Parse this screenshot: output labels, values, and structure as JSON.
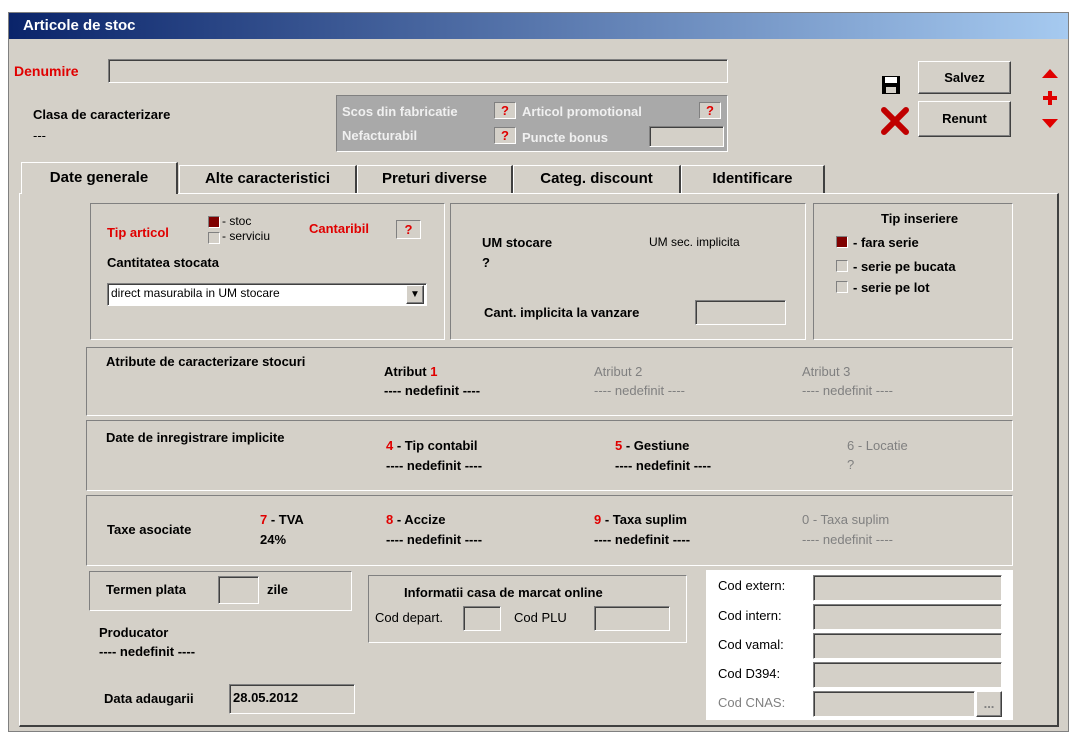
{
  "window": {
    "title": "Articole de stoc"
  },
  "header": {
    "denumire_label": "Denumire",
    "denumire_value": "",
    "clasa_label": "Clasa de caracterizare",
    "clasa_value": "---",
    "flags": {
      "scos_label": "Scos din fabricatie",
      "promo_label": "Articol promotional",
      "nefact_label": "Nefacturabil",
      "bonus_label": "Puncte bonus",
      "q": "?"
    },
    "save_label": "Salvez",
    "cancel_label": "Renunt"
  },
  "tabs": [
    "Date generale",
    "Alte caracteristici",
    "Preturi diverse",
    "Categ. discount",
    "Identificare"
  ],
  "tip_articol": {
    "label": "Tip articol",
    "opt_stoc": "- stoc",
    "opt_serviciu": "- serviciu",
    "cantaribil_label": "Cantaribil",
    "cantaribil_value": "?",
    "cantitate_label": "Cantitatea stocata",
    "cantitate_value": "direct masurabila in UM stocare"
  },
  "um": {
    "stocare_label": "UM stocare",
    "stocare_value": "?",
    "sec_label": "UM sec. implicita",
    "cant_vanzare_label": "Cant. implicita la vanzare"
  },
  "inseriere": {
    "title": "Tip inseriere",
    "opt1": "- fara serie",
    "opt2": "- serie pe bucata",
    "opt3": "- serie pe lot"
  },
  "atribute": {
    "title": "Atribute de caracterizare stocuri",
    "a1_label": "Atribut",
    "a1_num": "1",
    "a1_value": "---- nedefinit ----",
    "a2_label": "Atribut 2",
    "a2_value": "---- nedefinit ----",
    "a3_label": "Atribut 3",
    "a3_value": "---- nedefinit ----"
  },
  "inregistrare": {
    "title": "Date de inregistrare implicite",
    "tip_num": "4",
    "tip_label": " - Tip contabil",
    "tip_value": "---- nedefinit ----",
    "gest_num": "5",
    "gest_label": " - Gestiune",
    "gest_value": "---- nedefinit ----",
    "loc_label": "6 - Locatie",
    "loc_value": "?"
  },
  "taxe": {
    "title": "Taxe asociate",
    "tva_num": "7",
    "tva_label": " - TVA",
    "tva_value": "24%",
    "acc_num": "8",
    "acc_label": " - Accize",
    "acc_value": "---- nedefinit ----",
    "ts_num": "9",
    "ts_label": " - Taxa suplim",
    "ts_value": "---- nedefinit ----",
    "ts2_label": "0 - Taxa suplim",
    "ts2_value": "---- nedefinit ----"
  },
  "termen": {
    "label": "Termen plata",
    "unit": "zile"
  },
  "producator": {
    "label": "Producator",
    "value": "---- nedefinit ----"
  },
  "data_adaugarii": {
    "label": "Data adaugarii",
    "value": "28.05.2012"
  },
  "casa": {
    "title": "Informatii casa de marcat online",
    "depart_label": "Cod depart.",
    "plu_label": "Cod PLU"
  },
  "coduri": {
    "extern": "Cod extern:",
    "intern": "Cod intern:",
    "vamal": "Cod vamal:",
    "d394": "Cod D394:",
    "cnas": "Cod CNAS:",
    "browse": "..."
  }
}
